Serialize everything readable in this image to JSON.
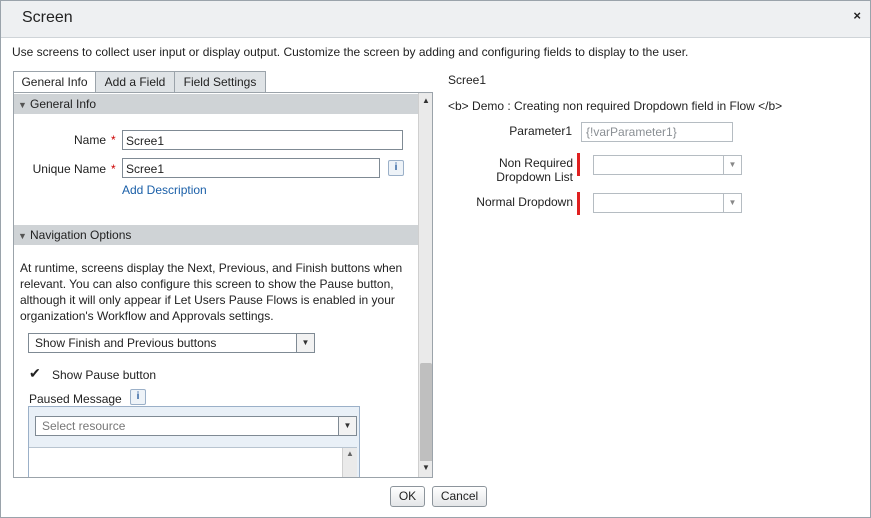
{
  "window": {
    "title": "Screen",
    "close_symbol": "×"
  },
  "intro": "Use screens to collect user input or display output. Customize the screen by adding and configuring fields to display to the user.",
  "tabs": [
    {
      "label": "General Info",
      "active": true
    },
    {
      "label": "Add a Field",
      "active": false
    },
    {
      "label": "Field Settings",
      "active": false
    }
  ],
  "general_info": {
    "header": "General Info",
    "name_label": "Name",
    "name_value": "Scree1",
    "unique_name_label": "Unique Name",
    "unique_name_value": "Scree1",
    "add_description": "Add Description",
    "required_mark": "*",
    "info_symbol": "i"
  },
  "navigation": {
    "header": "Navigation Options",
    "description": "At runtime, screens display the Next, Previous, and Finish buttons when relevant. You can also configure this screen to show the Pause button, although it will only appear if Let Users Pause Flows is enabled in your organization's Workflow and Approvals settings.",
    "button_option": "Show Finish and Previous buttons",
    "show_pause_checked": true,
    "show_pause_label": "Show Pause button",
    "paused_message_label": "Paused Message",
    "resource_placeholder": "Select resource"
  },
  "preview": {
    "screen_name": "Scree1",
    "display_text": "<b> Demo : Creating non required Dropdown field in Flow </b>",
    "parameter_label": "Parameter1",
    "parameter_value": "{!varParameter1}",
    "non_required_label_line1": "Non Required",
    "non_required_label_line2": "Dropdown List",
    "normal_dropdown_label": "Normal Dropdown"
  },
  "buttons": {
    "ok": "OK",
    "cancel": "Cancel"
  },
  "colors": {
    "required_bar": "#e02020",
    "link": "#1a5fa8",
    "section_header": "#cfd3d6"
  }
}
